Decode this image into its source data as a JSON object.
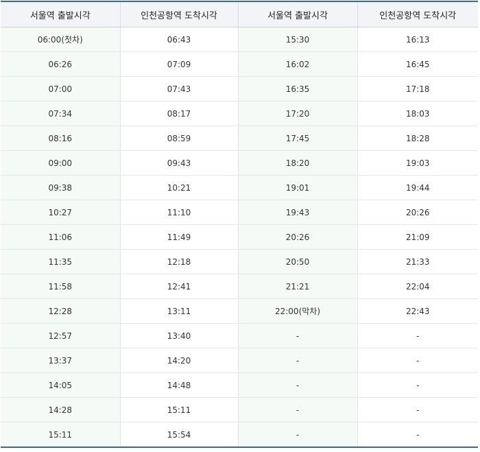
{
  "header": [
    "서울역 출발시각",
    "인천공항역 도착시각",
    "서울역 출발시각",
    "인천공항역 도착시각"
  ],
  "rows": [
    [
      "06:00(첫차)",
      "06:43",
      "15:30",
      "16:13"
    ],
    [
      "06:26",
      "07:09",
      "16:02",
      "16:45"
    ],
    [
      "07:00",
      "07:43",
      "16:35",
      "17:18"
    ],
    [
      "07:34",
      "08:17",
      "17:20",
      "18:03"
    ],
    [
      "08:16",
      "08:59",
      "17:45",
      "18:28"
    ],
    [
      "09:00",
      "09:43",
      "18:20",
      "19:03"
    ],
    [
      "09:38",
      "10:21",
      "19:01",
      "19:44"
    ],
    [
      "10:27",
      "11:10",
      "19:43",
      "20:26"
    ],
    [
      "11:06",
      "11:49",
      "20:26",
      "21:09"
    ],
    [
      "11:35",
      "12:18",
      "20:50",
      "21:33"
    ],
    [
      "11:58",
      "12:41",
      "21:21",
      "22:04"
    ],
    [
      "12:28",
      "13:11",
      "22:00(막차)",
      "22:43"
    ],
    [
      "12:57",
      "13:40",
      "-",
      "-"
    ],
    [
      "13:37",
      "14:20",
      "-",
      "-"
    ],
    [
      "14:05",
      "14:48",
      "-",
      "-"
    ],
    [
      "14:28",
      "15:11",
      "-",
      "-"
    ],
    [
      "15:11",
      "15:54",
      "-",
      "-"
    ]
  ],
  "colors": {
    "header_border": "#3b63a8",
    "header_bg": "#f2f4f8",
    "departure_col_bg": "#f4fbf6"
  }
}
